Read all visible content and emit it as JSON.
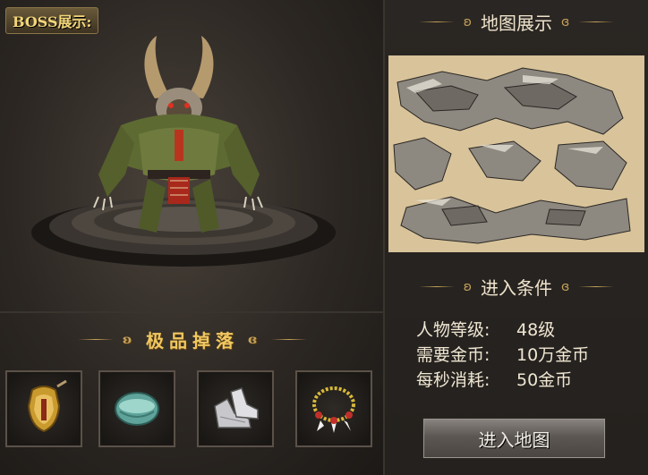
{
  "boss_panel": {
    "tag": "BOSS展示:"
  },
  "drops": {
    "title": "极品掉落",
    "items": [
      {
        "icon": "golden-armor-icon"
      },
      {
        "icon": "jade-bracelet-icon"
      },
      {
        "icon": "silver-boots-icon"
      },
      {
        "icon": "gem-necklace-icon"
      }
    ]
  },
  "map_panel": {
    "title": "地图展示"
  },
  "conditions": {
    "title": "进入条件",
    "rows": [
      {
        "label": "人物等级:",
        "value": "48级"
      },
      {
        "label": "需要金币:",
        "value": "10万金币"
      },
      {
        "label": "每秒消耗:",
        "value": "50金币"
      }
    ]
  },
  "enter_button": "进入地图",
  "colors": {
    "gold_accent": "#c7a35a",
    "drop_title": "#f0c860",
    "map_sand": "#d8c39a"
  }
}
